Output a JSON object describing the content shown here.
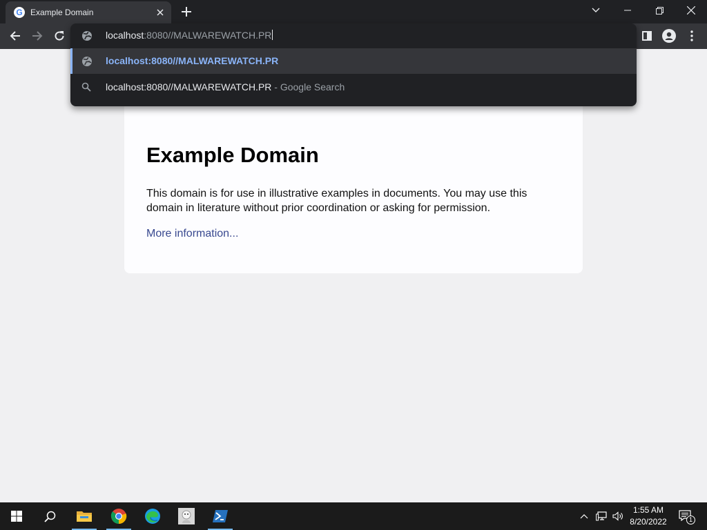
{
  "browser": {
    "tab": {
      "title": "Example Domain",
      "favicon": "google-g-icon"
    },
    "new_tab_icon": "plus-icon",
    "window_controls": [
      "chevron-down-icon",
      "minimize-icon",
      "restore-icon",
      "close-icon"
    ],
    "toolbar": [
      "back-icon",
      "forward-icon",
      "reload-icon",
      "side-panel-icon",
      "profile-icon",
      "menu-icon"
    ]
  },
  "omnibox": {
    "input_host": "localhost",
    "input_rest": ":8080//MALWAREWATCH.PR",
    "suggestions": [
      {
        "icon": "globe-icon",
        "text": "localhost:8080//MALWAREWATCH.PR",
        "desc": ""
      },
      {
        "icon": "search-icon",
        "text": "localhost:8080//MALWAREWATCH.PR",
        "desc": " - Google Search"
      }
    ]
  },
  "page": {
    "heading": "Example Domain",
    "paragraph": "This domain is for use in illustrative examples in documents. You may use this domain in literature without prior coordination or asking for permission.",
    "link": "More information..."
  },
  "taskbar": {
    "apps": [
      "start-icon",
      "search-icon",
      "file-explorer-icon",
      "chrome-icon",
      "edge-icon",
      "app-icon",
      "powershell-icon"
    ],
    "time": "1:55 AM",
    "date": "8/20/2022",
    "notification_count": "1"
  },
  "colors": {
    "accent": "#8ab4f8",
    "link": "#38488f",
    "taskbar": "#1b1b1b",
    "titlebar": "#202124"
  }
}
